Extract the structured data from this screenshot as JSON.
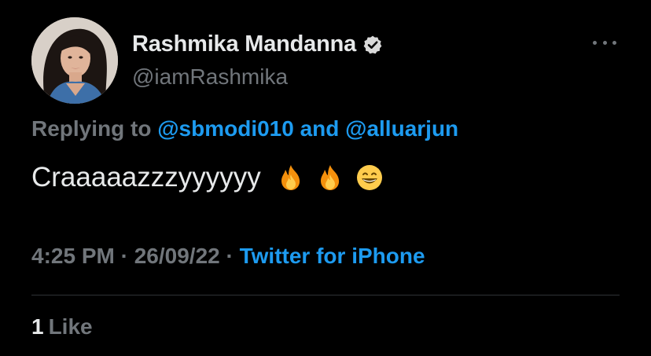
{
  "author": {
    "display_name": "Rashmika Mandanna",
    "handle": "@iamRashmika",
    "verified": true,
    "avatar_icon": "profile-photo"
  },
  "reply": {
    "prefix": "Replying to",
    "mention_1": "@sbmodi010",
    "joiner": "and",
    "mention_2": "@alluarjun"
  },
  "tweet": {
    "text": "Craaaaazzzyyyyyy",
    "emojis": [
      "fire-emoji",
      "fire-emoji",
      "grinning-face-emoji"
    ]
  },
  "meta": {
    "time": "4:25 PM",
    "separator_1": "·",
    "date": "26/09/22",
    "separator_2": "·",
    "source": "Twitter for iPhone"
  },
  "stats": {
    "like_count": "1",
    "like_label": "Like"
  },
  "colors": {
    "background": "#000000",
    "primary_text": "#e7e9ea",
    "secondary_text": "#71767b",
    "accent": "#1d9bf0",
    "divider": "#2f3336"
  }
}
